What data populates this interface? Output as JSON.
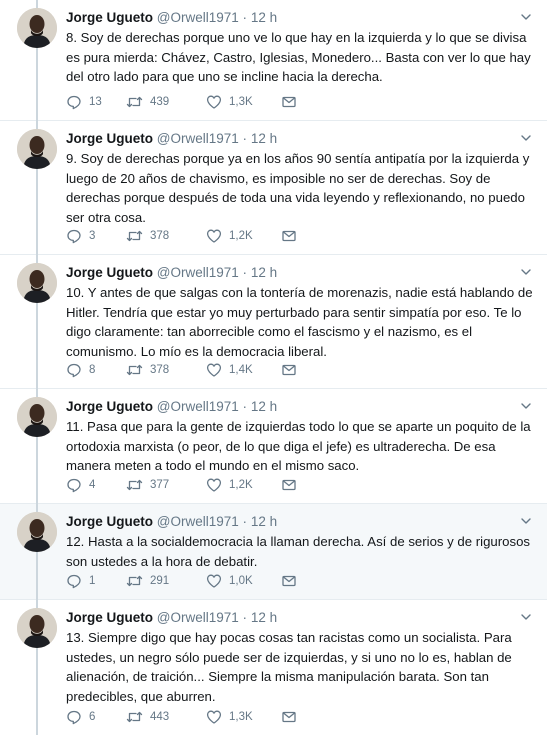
{
  "thread": {
    "tweets": [
      {
        "name": "Jorge Ugueto",
        "handle": "@Orwell1971",
        "dot": "·",
        "time": "12 h",
        "text": "8. Soy de derechas porque uno ve lo que hay en la izquierda y lo que se divisa\nes pura mierda: Chávez, Castro, Iglesias, Monedero... Basta con ver lo que hay\ndel otro lado para que uno se incline hacia la derecha.",
        "replies": "13",
        "retweets": "439",
        "likes": "1,3K"
      },
      {
        "name": "Jorge Ugueto",
        "handle": "@Orwell1971",
        "dot": "·",
        "time": "12 h",
        "text": "9. Soy de derechas porque ya en los años 90 sentía antipatía por la izquierda y\nluego de 20 años de chavismo, es imposible no ser de derechas. Soy de\nderechas porque después de toda una vida leyendo y reflexionando, no puedo\nser otra cosa.",
        "replies": "3",
        "retweets": "378",
        "likes": "1,2K"
      },
      {
        "name": "Jorge Ugueto",
        "handle": "@Orwell1971",
        "dot": "·",
        "time": "12 h",
        "text": "10. Y antes de que salgas con la tontería de morenazis, nadie está hablando de\nHitler. Tendría que estar yo muy perturbado para sentir simpatía por eso. Te lo\ndigo claramente: tan aborrecible como el fascismo y el nazismo, es el\ncomunismo. Lo mío es la democracia liberal.",
        "replies": "8",
        "retweets": "378",
        "likes": "1,4K"
      },
      {
        "name": "Jorge Ugueto",
        "handle": "@Orwell1971",
        "dot": "·",
        "time": "12 h",
        "text": "11. Pasa que para la gente de izquierdas todo lo que se aparte un poquito de la\nortodoxia marxista (o peor, de lo que diga el jefe) es ultraderecha. De esa\nmanera meten a todo el mundo en el mismo saco.",
        "replies": "4",
        "retweets": "377",
        "likes": "1,2K"
      },
      {
        "name": "Jorge Ugueto",
        "handle": "@Orwell1971",
        "dot": "·",
        "time": "12 h",
        "text": "12. Hasta a la socialdemocracia la llaman derecha. Así de serios y de rigurosos\nson ustedes a la hora de debatir.",
        "replies": "1",
        "retweets": "291",
        "likes": "1,0K"
      },
      {
        "name": "Jorge Ugueto",
        "handle": "@Orwell1971",
        "dot": "·",
        "time": "12 h",
        "text": "13. Siempre digo que hay pocas cosas tan racistas como un socialista. Para\nustedes, un negro sólo puede ser de izquierdas, y si uno no lo es, hablan de\nalienación, de traición... Siempre la misma manipulación barata. Son tan\npredecibles, que aburren.",
        "replies": "6",
        "retweets": "443",
        "likes": "1,3K"
      }
    ]
  },
  "colors": {
    "text": "#14171a",
    "muted": "#657786",
    "thread_line": "#ccd6dd",
    "highlight_bg": "#f5f8fa",
    "divider": "#e6ecf0"
  },
  "icons": [
    "avatar",
    "chevron-down-icon",
    "reply-icon",
    "retweet-icon",
    "like-icon",
    "direct-message-icon"
  ]
}
